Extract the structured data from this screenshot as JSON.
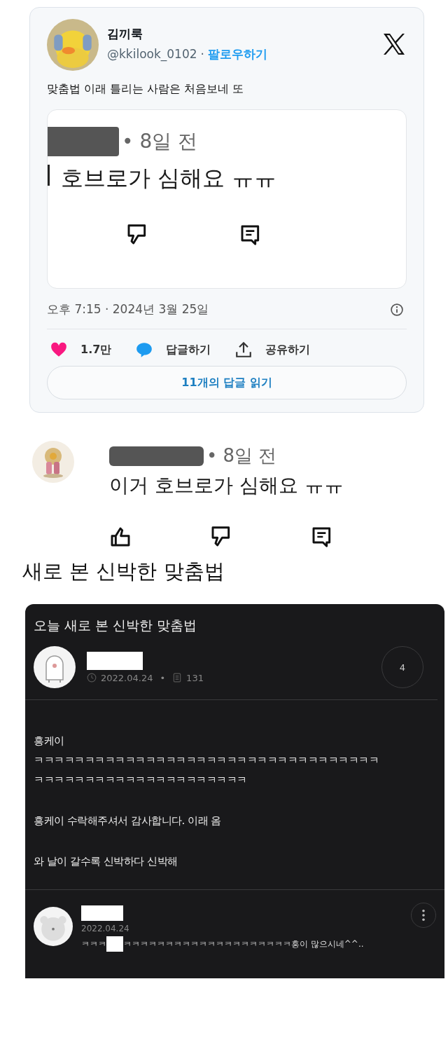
{
  "tweet": {
    "author_name": "김끼룩",
    "handle": "@kkilook_0102",
    "separator": "·",
    "follow_label": "팔로우하기",
    "text": "맞춤법 이래 틀리는 사람은 처음보네 또",
    "embedded": {
      "time_ago": "• 8일 전",
      "comment": "호브로가 심해요 ㅠㅠ"
    },
    "timestamp": "오후 7:15 · 2024년 3월 25일",
    "likes": "1.7만",
    "reply_label": "답글하기",
    "share_label": "공유하기",
    "read_replies": "11개의 답글 읽기"
  },
  "comment": {
    "time_ago": "• 8일 전",
    "text": "이거 호브로가 심해요 ㅠㅠ"
  },
  "caption": "새로 본 신박한 맞춤법",
  "post": {
    "title": "오늘 새로 본 신박한 맞춤법",
    "date": "2022.04.24",
    "dot": "•",
    "views": "131",
    "comment_count": "4",
    "paragraphs": [
      {
        "lines": [
          "흥케이",
          "ㅋㅋㅋㅋㅋㅋㅋㅋㅋㅋㅋㅋㅋㅋㅋㅋㅋㅋㅋㅋㅋㅋㅋㅋㅋㅋㅋㅋㅋㅋㅋㅋㅋㅋ",
          "ㅋㅋㅋㅋㅋㅋㅋㅋㅋㅋㅋㅋㅋㅋㅋㅋㅋㅋㅋㅋㅋ"
        ]
      },
      {
        "lines": [
          "흥케이 수락해주셔서 감사합니다. 이래 옴"
        ]
      },
      {
        "lines": [
          "와 날이 갈수록 신박하다 신박해"
        ]
      }
    ],
    "reply": {
      "date": "2022.04.24",
      "text_before": "ㅋㅋㅋ",
      "text_after": "ㅋㅋㅋㅋㅋㅋㅋㅋㅋㅋㅋㅋㅋㅋㅋㅋㅋㅋㅋㅋ흥이 많으시네^^.."
    }
  }
}
